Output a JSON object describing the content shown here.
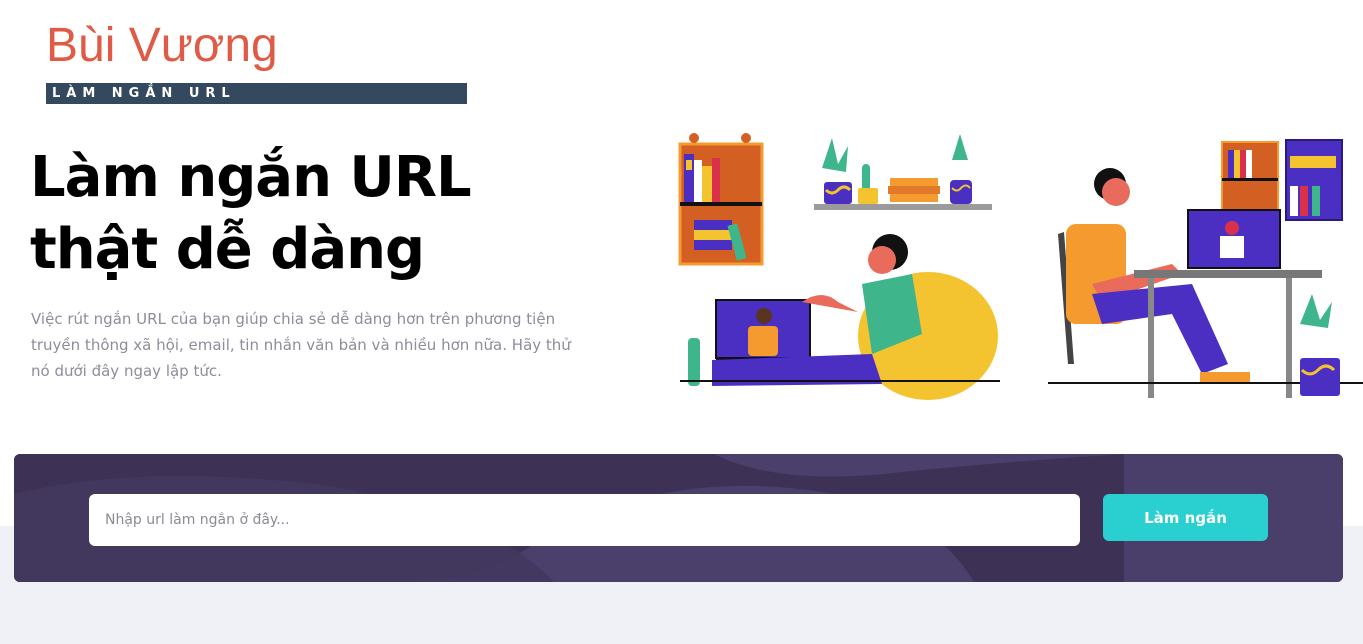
{
  "brand": {
    "title": "Bùi Vương",
    "subtitle": "LÀM NGẮN URL",
    "title_color": "#e05b46",
    "subtitle_bg": "#34495e"
  },
  "hero": {
    "title_line1": "Làm ngắn URL",
    "title_line2": "thật dễ dàng",
    "description": "Việc rút ngắn URL của bạn giúp chia sẻ dễ dàng hơn trên phương tiện truyền thông xã hội, email, tin nhắn văn bản và nhiều hơn nữa. Hãy thử nó dưới đây ngay lập tức."
  },
  "illustration": {
    "icon": "remote-video-call-illustration"
  },
  "shortener": {
    "input_value": "",
    "input_placeholder": "Nhập url làm ngắn ở đây...",
    "button_label": "Làm ngắn",
    "panel_color": "#4b3f6b",
    "button_color": "#2acfcf"
  },
  "page": {
    "bottom_bg_color": "#eff1f7"
  }
}
